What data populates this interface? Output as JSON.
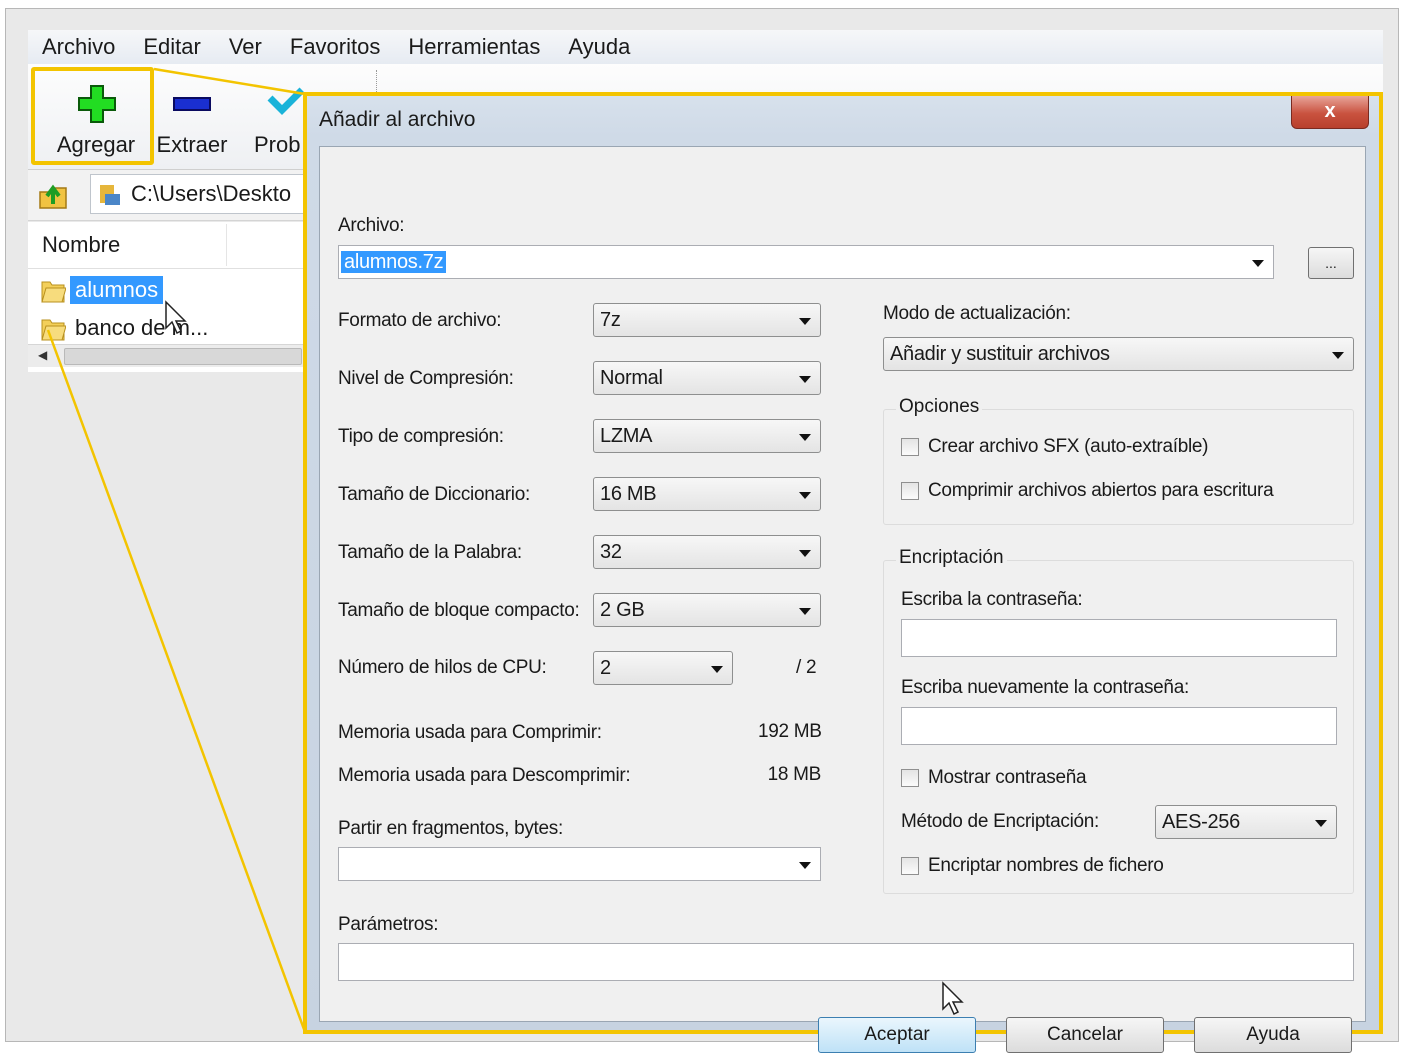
{
  "menubar": {
    "items": [
      "Archivo",
      "Editar",
      "Ver",
      "Favoritos",
      "Herramientas",
      "Ayuda"
    ]
  },
  "toolbar": {
    "add_label": "Agregar",
    "extract_label": "Extraer",
    "test_label": "Prob"
  },
  "addressbar": {
    "path": "C:\\Users\\Deskto"
  },
  "filelist": {
    "column_name": "Nombre",
    "items": [
      "alumnos",
      "banco de m..."
    ]
  },
  "dialog": {
    "title": "Añadir al archivo",
    "close_label": "x",
    "archive_label": "Archivo:",
    "archive_value": "alumnos.7z",
    "browse_label": "...",
    "format_label": "Formato de archivo:",
    "format_value": "7z",
    "level_label": "Nivel de Compresión:",
    "level_value": "Normal",
    "method_label": "Tipo de compresión:",
    "method_value": "LZMA",
    "dict_label": "Tamaño de Diccionario:",
    "dict_value": "16 MB",
    "word_label": "Tamaño de la Palabra:",
    "word_value": "32",
    "solid_label": "Tamaño de bloque compacto:",
    "solid_value": "2 GB",
    "threads_label": "Número de hilos de CPU:",
    "threads_value": "2",
    "threads_max": "/ 2",
    "mem_compress_label": "Memoria usada para Comprimir:",
    "mem_compress_value": "192 MB",
    "mem_decompress_label": "Memoria usada para Descomprimir:",
    "mem_decompress_value": "18 MB",
    "split_label": "Partir en fragmentos, bytes:",
    "split_value": "",
    "params_label": "Parámetros:",
    "params_value": "",
    "update_mode_label": "Modo de actualización:",
    "update_mode_value": "Añadir y sustituir archivos",
    "options_title": "Opciones",
    "opt_sfx": "Crear archivo SFX (auto-extraíble)",
    "opt_shared": "Comprimir archivos abiertos para escritura",
    "encryption_title": "Encriptación",
    "password_label": "Escriba la contraseña:",
    "password_value": "",
    "password2_label": "Escriba nuevamente la contraseña:",
    "password2_value": "",
    "show_password": "Mostrar contraseña",
    "enc_method_label": "Método de Encriptación:",
    "enc_method_value": "AES-256",
    "encrypt_names": "Encriptar nombres de fichero",
    "ok_label": "Aceptar",
    "cancel_label": "Cancelar",
    "help_label": "Ayuda"
  },
  "colors": {
    "highlight": "#f3c400",
    "selection": "#3399ff"
  },
  "icons": [
    "add-icon",
    "extract-icon",
    "test-icon",
    "up-folder-icon",
    "folder-icon",
    "mouse-cursor-icon",
    "dropdown-arrow-icon"
  ]
}
